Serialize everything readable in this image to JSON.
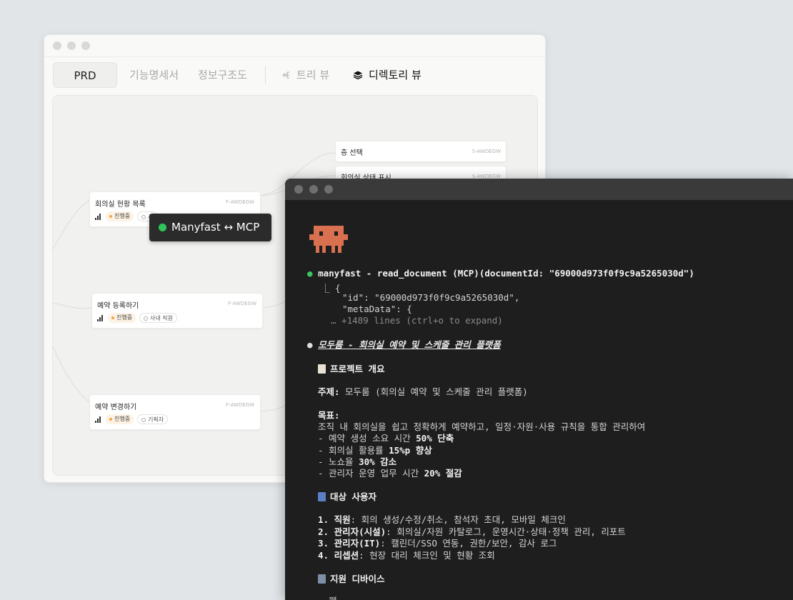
{
  "back_window": {
    "tabs": {
      "prd": "PRD",
      "func_spec": "기능명세서",
      "ia": "정보구조도",
      "tree_view": "트리 뷰",
      "dir_view": "디렉토리 뷰"
    },
    "nodes": [
      {
        "title": "회의실 현황 목록",
        "code": "F-AWDEGW",
        "status": "진행중",
        "person": "사"
      },
      {
        "title": "예약 등록하기",
        "code": "F-AWDEGW",
        "status": "진행중",
        "person": "사내 직원"
      },
      {
        "title": "예약 변경하기",
        "code": "F-AWDEGW",
        "status": "진행중",
        "person": "기획자"
      }
    ],
    "screens": [
      {
        "title": "층 선택",
        "code": "S-AWDEGW"
      },
      {
        "title": "회의실 상태 표시",
        "code": "S-AWDEGW"
      }
    ],
    "badge": {
      "label": "Manyfast ↔ MCP",
      "dot_color": "#2fc45a"
    }
  },
  "terminal": {
    "mascot_color": "#d9704f",
    "tool_call": "manyfast - read_document (MCP)(documentId: \"69000d973f0f9c9a5265030d\")",
    "json_open": "⎿ {",
    "json_id": "\"id\": \"69000d973f0f9c9a5265030d\",",
    "json_meta": "\"metaData\": {",
    "json_more": "… +1489 lines (ctrl+o to expand)",
    "doc_title": "모두룸 - 회의실 예약 및 스케줄 관리 플랫폼",
    "overview_heading": "프로젝트 개요",
    "topic_label": "주제:",
    "topic_value": " 모두룸 (회의실 예약 및 스케줄 관리 플랫폼)",
    "goal_label": "목표:",
    "goal_desc": "조직 내 회의실을 쉽고 정확하게 예약하고, 일정·자원·사용 규칙을 통합 관리하여",
    "goals": [
      {
        "pre": "- 예약 생성 소요 시간 ",
        "strong": "50% 단축"
      },
      {
        "pre": "- 회의실 활용률 ",
        "strong": "15%p 향상"
      },
      {
        "pre": "- 노쇼율 ",
        "strong": "30% 감소"
      },
      {
        "pre": "- 관리자 운영 업무 시간 ",
        "strong": "20% 절감"
      }
    ],
    "users_heading": "대상 사용자",
    "users": [
      {
        "num": "1. ",
        "strong": "직원",
        "rest": ": 회의 생성/수정/취소, 참석자 초대, 모바일 체크인"
      },
      {
        "num": "2. ",
        "strong": "관리자(시설)",
        "rest": ": 회의실/자원 카탈로그, 운영시간·상태·정책 관리, 리포트"
      },
      {
        "num": "3. ",
        "strong": "관리자(IT)",
        "rest": ": 캘린더/SSO 연동, 권한/보안, 감사 로그"
      },
      {
        "num": "4. ",
        "strong": "리셉션",
        "rest": ": 현장 대리 체크인 및 현황 조회"
      }
    ],
    "devices_heading": "지원 디바이스",
    "devices_first": "웹"
  }
}
